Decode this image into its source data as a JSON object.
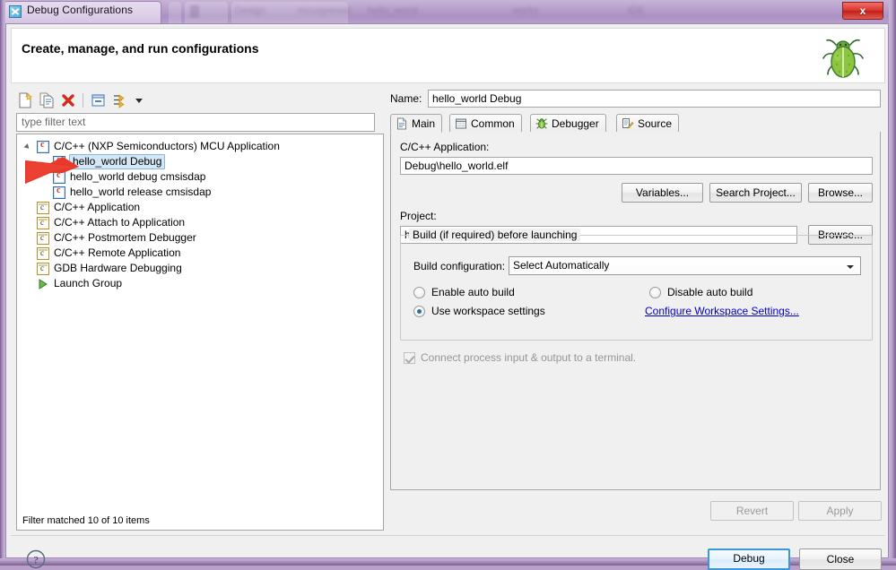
{
  "window": {
    "title": "Debug Configurations",
    "app_icon": "eclipse-x-icon",
    "close_label": "x"
  },
  "banner": {
    "title": "Create, manage, and run configurations",
    "icon": "green-bug-icon"
  },
  "left_panel": {
    "toolbar": [
      {
        "name": "new-launch-configuration-icon",
        "tooltip": "New launch configuration"
      },
      {
        "name": "duplicate-icon",
        "tooltip": "Duplicate"
      },
      {
        "name": "delete-icon",
        "tooltip": "Delete"
      },
      {
        "name": "collapse-all-icon",
        "tooltip": "Collapse All"
      },
      {
        "name": "filter-icon",
        "tooltip": "Filter launch configurations"
      },
      {
        "name": "chevron-down-icon",
        "tooltip": "View Menu"
      }
    ],
    "filter_placeholder": "type filter text",
    "filter_value": "",
    "status": "Filter matched 10 of 10 items",
    "tree": [
      {
        "label": "C/C++ (NXP Semiconductors) MCU Application",
        "level": 0,
        "icon": "mcu",
        "expanded": true,
        "selected": false
      },
      {
        "label": "hello_world Debug",
        "level": 1,
        "icon": "mcu",
        "selected": true
      },
      {
        "label": "hello_world debug cmsisdap",
        "level": 1,
        "icon": "mcu",
        "selected": false
      },
      {
        "label": "hello_world release cmsisdap",
        "level": 1,
        "icon": "mcu",
        "selected": false
      },
      {
        "label": "C/C++ Application",
        "level": 0,
        "icon": "cpp",
        "selected": false
      },
      {
        "label": "C/C++ Attach to Application",
        "level": 0,
        "icon": "cpp",
        "selected": false
      },
      {
        "label": "C/C++ Postmortem Debugger",
        "level": 0,
        "icon": "cpp",
        "selected": false
      },
      {
        "label": "C/C++ Remote Application",
        "level": 0,
        "icon": "cpp",
        "selected": false
      },
      {
        "label": "GDB Hardware Debugging",
        "level": 0,
        "icon": "cpp",
        "selected": false
      },
      {
        "label": "Launch Group",
        "level": 0,
        "icon": "launch",
        "selected": false
      }
    ]
  },
  "right_panel": {
    "name_label": "Name:",
    "name_value": "hello_world Debug",
    "tabs": [
      {
        "label": "Main",
        "icon": "document-icon",
        "active": true
      },
      {
        "label": "Common",
        "icon": "table-icon",
        "active": false
      },
      {
        "label": "Debugger",
        "icon": "bug-icon",
        "active": false
      },
      {
        "label": "Source",
        "icon": "source-lookup-icon",
        "active": false
      }
    ],
    "main_tab": {
      "application_label": "C/C++ Application:",
      "application_value": "Debug\\hello_world.elf",
      "variables_button": "Variables...",
      "search_project_button": "Search Project...",
      "browse_button_app": "Browse...",
      "project_label": "Project:",
      "project_value": "hello_world",
      "browse_button_project": "Browse...",
      "build_group_legend": "Build (if required) before launching",
      "build_configuration_label": "Build configuration:",
      "build_configuration_value": "Select Automatically",
      "radio_enable_auto_build": "Enable auto build",
      "radio_disable_auto_build": "Disable auto build",
      "radio_use_workspace_settings": "Use workspace settings",
      "configure_workspace_link": "Configure Workspace Settings...",
      "terminal_checkbox_label": "Connect process input & output to a terminal.",
      "terminal_checked": true,
      "terminal_enabled": false,
      "selected_radio": "use_workspace_settings"
    },
    "revert_button": "Revert",
    "apply_button": "Apply"
  },
  "footer": {
    "help_icon": "question-mark-icon",
    "debug_button": "Debug",
    "close_button": "Close"
  },
  "annotation": {
    "arrow": "red-arrow-pointing-right",
    "color": "#e8392a"
  },
  "colors": {
    "titlebar": "#b79fcb",
    "dialog_bg": "#f0f0f0",
    "selection": "#d4e7f7",
    "link": "#0000c0",
    "accent_blue": "#3c97d8"
  }
}
